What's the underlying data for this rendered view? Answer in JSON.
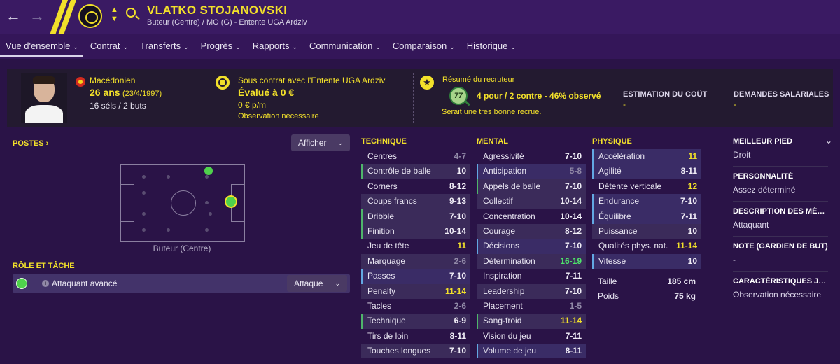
{
  "header": {
    "player_name": "VLATKO STOJANOVSKI",
    "subtitle": "Buteur (Centre) / MO (G) - Entente UGA Ardziv"
  },
  "tabs": [
    {
      "label": "Vue d'ensemble"
    },
    {
      "label": "Contrat"
    },
    {
      "label": "Transferts"
    },
    {
      "label": "Progrès"
    },
    {
      "label": "Rapports"
    },
    {
      "label": "Communication"
    },
    {
      "label": "Comparaison"
    },
    {
      "label": "Historique"
    }
  ],
  "summary": {
    "nationality": "Macédonien",
    "age": "26 ans",
    "birthdate": "(23/4/1997)",
    "caps": "16 séls / 2 buts",
    "contract_text": "Sous contrat avec l'Entente UGA Ardziv",
    "valuation": "Évalué à 0 €",
    "wage": "0 € p/m",
    "observation": "Observation nécessaire",
    "scout_title": "Résumé du recruteur",
    "scout_score": "77",
    "scout_summary": "4 pour / 2 contre - 46% observé",
    "scout_note": "Serait une très bonne recrue.",
    "cost_label": "ESTIMATION DU COÛT",
    "cost_value": "-",
    "wage_demand_label": "DEMANDES SALARIALES",
    "wage_demand_value": "-"
  },
  "positions": {
    "title": "POSTES",
    "display_button": "Afficher",
    "position_name": "Buteur (Centre)"
  },
  "role": {
    "title": "RÔLE ET TÂCHE",
    "role_name": "Attaquant avancé",
    "duty": "Attaque"
  },
  "attributes": {
    "technique": {
      "title": "TECHNIQUE",
      "rows": [
        {
          "name": "Centres",
          "value": "4-7",
          "style": "low"
        },
        {
          "name": "Contrôle de balle",
          "value": "10",
          "style": "",
          "mark": "green"
        },
        {
          "name": "Corners",
          "value": "8-12",
          "style": ""
        },
        {
          "name": "Coups francs",
          "value": "9-13",
          "style": ""
        },
        {
          "name": "Dribble",
          "value": "7-10",
          "style": "",
          "mark": "green"
        },
        {
          "name": "Finition",
          "value": "10-14",
          "style": "",
          "mark": "green"
        },
        {
          "name": "Jeu de tête",
          "value": "11",
          "style": "yellow"
        },
        {
          "name": "Marquage",
          "value": "2-6",
          "style": "low"
        },
        {
          "name": "Passes",
          "value": "7-10",
          "style": "",
          "mark": "blue"
        },
        {
          "name": "Penalty",
          "value": "11-14",
          "style": "yellow"
        },
        {
          "name": "Tacles",
          "value": "2-6",
          "style": "low"
        },
        {
          "name": "Technique",
          "value": "6-9",
          "style": "",
          "mark": "green"
        },
        {
          "name": "Tirs de loin",
          "value": "8-11",
          "style": ""
        },
        {
          "name": "Touches longues",
          "value": "7-10",
          "style": ""
        }
      ]
    },
    "mental": {
      "title": "MENTAL",
      "rows": [
        {
          "name": "Agressivité",
          "value": "7-10",
          "style": ""
        },
        {
          "name": "Anticipation",
          "value": "5-8",
          "style": "low",
          "mark": "blue"
        },
        {
          "name": "Appels de balle",
          "value": "7-10",
          "style": "",
          "mark": "green"
        },
        {
          "name": "Collectif",
          "value": "10-14",
          "style": ""
        },
        {
          "name": "Concentration",
          "value": "10-14",
          "style": ""
        },
        {
          "name": "Courage",
          "value": "8-12",
          "style": ""
        },
        {
          "name": "Décisions",
          "value": "7-10",
          "style": "",
          "mark": "blue"
        },
        {
          "name": "Détermination",
          "value": "16-19",
          "style": "green"
        },
        {
          "name": "Inspiration",
          "value": "7-11",
          "style": ""
        },
        {
          "name": "Leadership",
          "value": "7-10",
          "style": ""
        },
        {
          "name": "Placement",
          "value": "1-5",
          "style": "low"
        },
        {
          "name": "Sang-froid",
          "value": "11-14",
          "style": "yellow",
          "mark": "green"
        },
        {
          "name": "Vision du jeu",
          "value": "7-11",
          "style": ""
        },
        {
          "name": "Volume de jeu",
          "value": "8-11",
          "style": "",
          "mark": "blue"
        }
      ]
    },
    "physique": {
      "title": "PHYSIQUE",
      "rows": [
        {
          "name": "Accélération",
          "value": "11",
          "style": "yellow",
          "mark": "blue"
        },
        {
          "name": "Agilité",
          "value": "8-11",
          "style": "",
          "mark": "blue"
        },
        {
          "name": "Détente verticale",
          "value": "12",
          "style": "yellow"
        },
        {
          "name": "Endurance",
          "value": "7-10",
          "style": "",
          "mark": "blue"
        },
        {
          "name": "Équilibre",
          "value": "7-11",
          "style": "",
          "mark": "blue"
        },
        {
          "name": "Puissance",
          "value": "10",
          "style": ""
        },
        {
          "name": "Qualités phys. nat.",
          "value": "11-14",
          "style": "yellow"
        },
        {
          "name": "Vitesse",
          "value": "10",
          "style": "",
          "mark": "blue"
        }
      ],
      "height_label": "Taille",
      "height_value": "185 cm",
      "weight_label": "Poids",
      "weight_value": "75 kg"
    }
  },
  "side": {
    "foot_label": "MEILLEUR PIED",
    "foot_value": "Droit",
    "personality_label": "PERSONNALITÉ",
    "personality_value": "Assez déterminé",
    "media_label": "DESCRIPTION DES MÉD...",
    "media_value": "Attaquant",
    "gk_label": "NOTE (GARDIEN DE BUT)",
    "gk_value": "-",
    "char_label": "CARACTÉRISTIQUES JO...",
    "char_value": "Observation nécessaire"
  },
  "colors": {
    "accent": "#f2e02a",
    "background": "#2a1347",
    "panel": "#231a30"
  }
}
